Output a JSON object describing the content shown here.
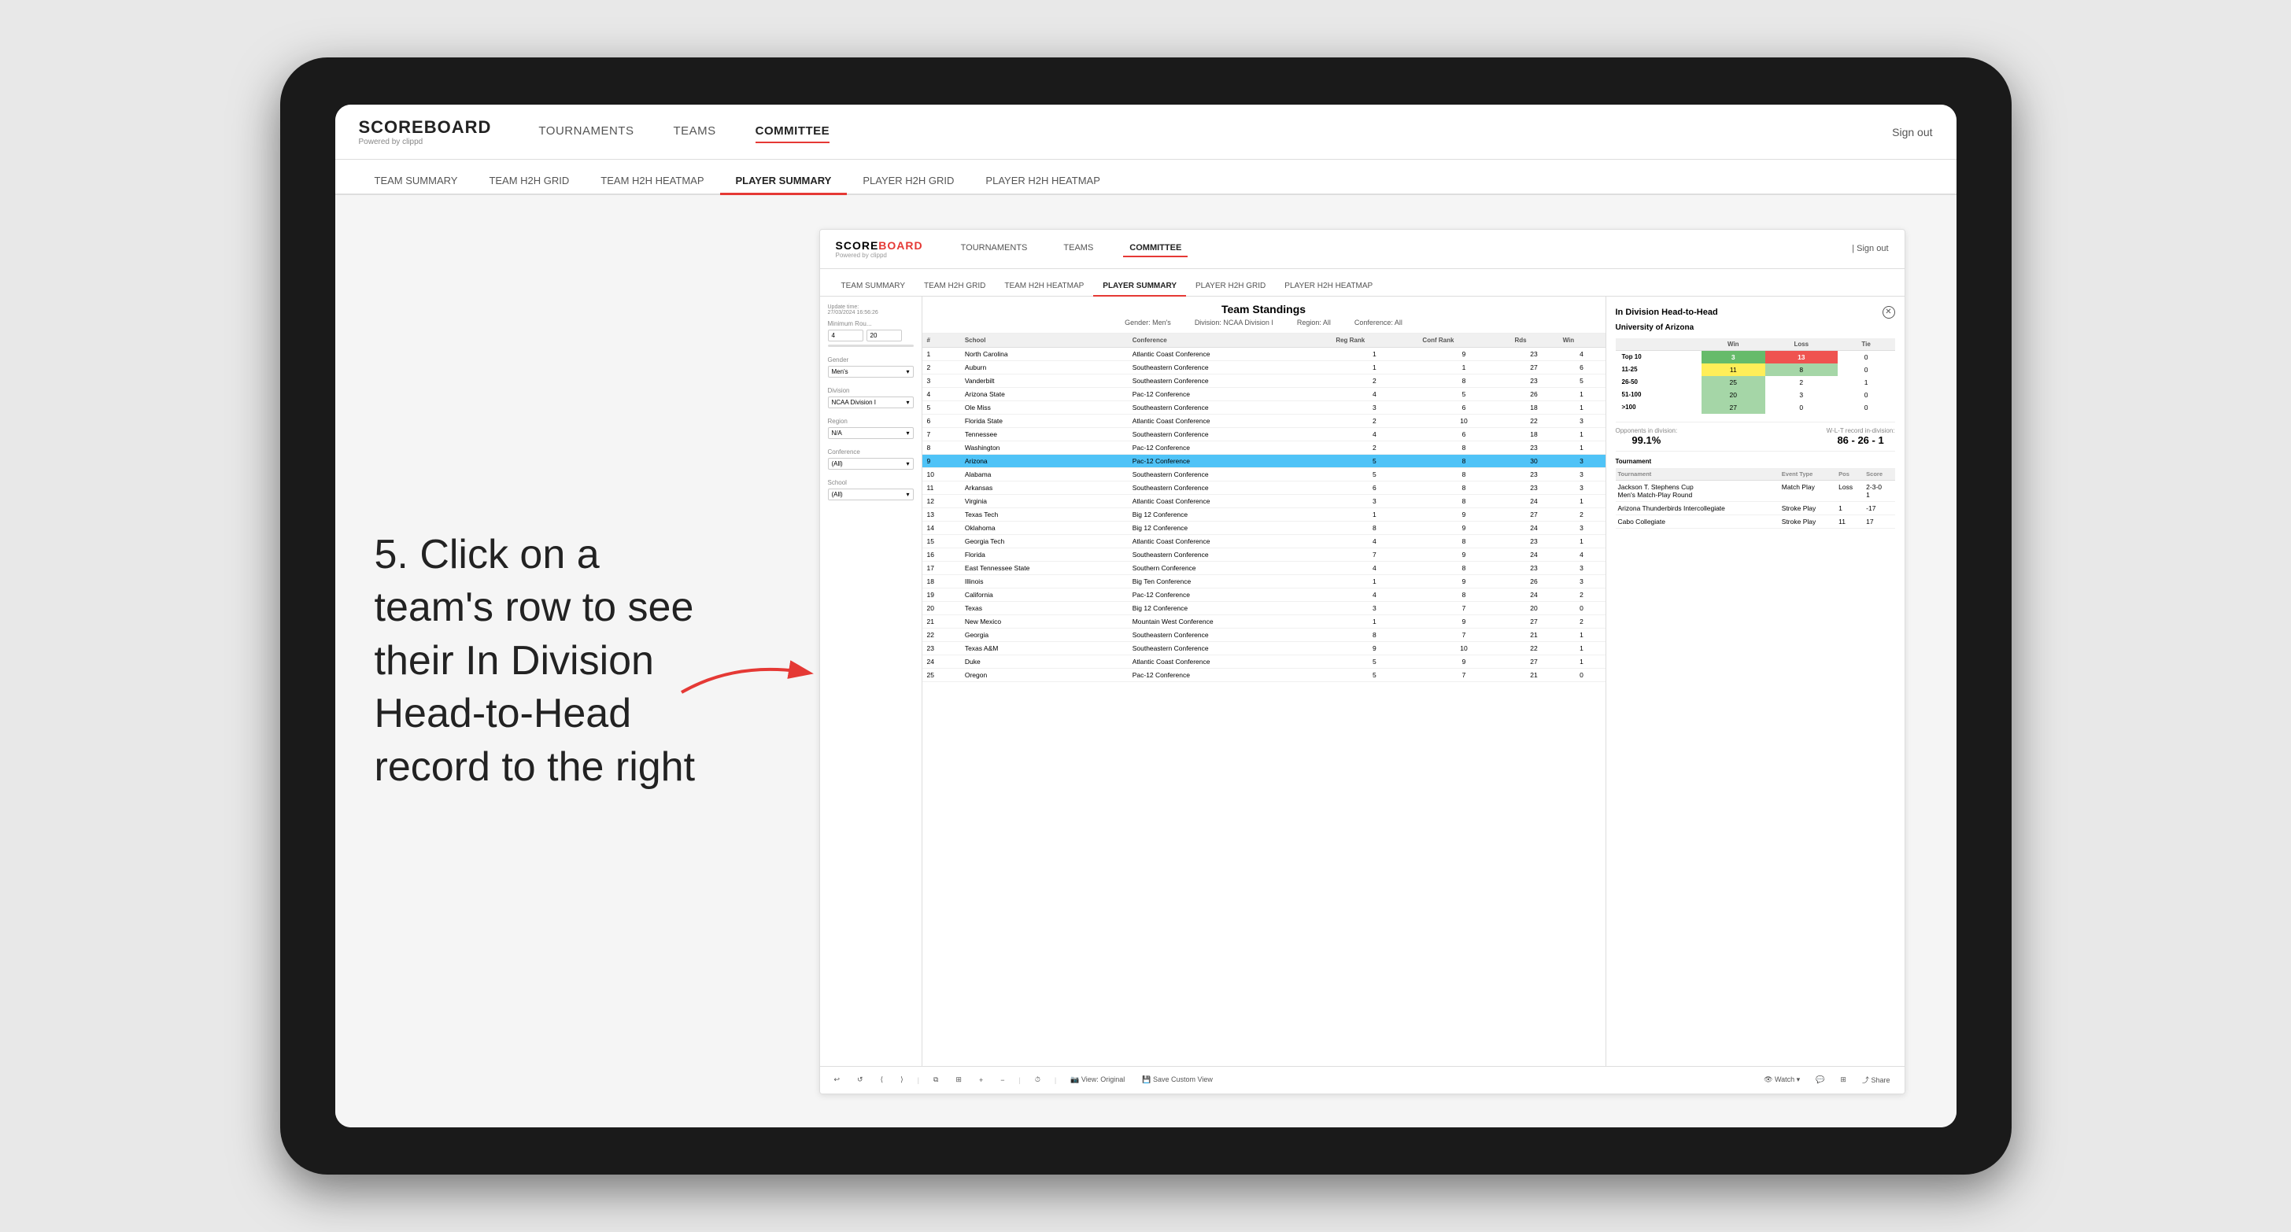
{
  "page": {
    "background": "#e8e8e8"
  },
  "nav": {
    "logo": "SCOREBOARD",
    "logo_sub": "Powered by clippd",
    "links": [
      "TOURNAMENTS",
      "TEAMS",
      "COMMITTEE"
    ],
    "active_link": "COMMITTEE",
    "sign_out": "Sign out",
    "sub_links": [
      "TEAM SUMMARY",
      "TEAM H2H GRID",
      "TEAM H2H HEATMAP",
      "PLAYER SUMMARY",
      "PLAYER H2H GRID",
      "PLAYER H2H HEATMAP"
    ],
    "active_sub": "PLAYER SUMMARY"
  },
  "instruction": {
    "text": "5. Click on a team's row to see their In Division Head-to-Head record to the right"
  },
  "app": {
    "header": {
      "logo": "SCOREBOARD",
      "logo_sub": "Powered by clippd",
      "nav_items": [
        "TOURNAMENTS",
        "TEAMS",
        "COMMITTEE"
      ],
      "active_nav": "COMMITTEE",
      "sign_out": "| Sign out"
    },
    "sub_nav": [
      "TEAM SUMMARY",
      "TEAM H2H GRID",
      "TEAM H2H HEATMAP",
      "PLAYER SUMMARY",
      "PLAYER H2H GRID",
      "PLAYER H2H HEATMAP"
    ],
    "active_sub": "PLAYER SUMMARY",
    "update_time": "Update time:\n27/03/2024 16:56:26",
    "table_title": "Team Standings",
    "meta": {
      "gender": "Gender: Men's",
      "division": "Division: NCAA Division I",
      "region": "Region: All",
      "conference": "Conference: All"
    },
    "filters": {
      "min_rounds_label": "Minimum Rou...",
      "min_val": "4",
      "max_val": "20",
      "gender_label": "Gender",
      "gender_val": "Men's",
      "division_label": "Division",
      "division_val": "NCAA Division I",
      "region_label": "Region",
      "region_val": "N/A",
      "conference_label": "Conference",
      "conference_val": "(All)",
      "school_label": "School",
      "school_val": "(All)"
    },
    "table_headers": [
      "#",
      "School",
      "Conference",
      "Reg Rank",
      "Conf Rank",
      "Rds",
      "Win"
    ],
    "table_rows": [
      {
        "num": "1",
        "school": "North Carolina",
        "conference": "Atlantic Coast Conference",
        "reg": "1",
        "conf": "9",
        "rds": "23",
        "win": "4"
      },
      {
        "num": "2",
        "school": "Auburn",
        "conference": "Southeastern Conference",
        "reg": "1",
        "conf": "1",
        "rds": "27",
        "win": "6"
      },
      {
        "num": "3",
        "school": "Vanderbilt",
        "conference": "Southeastern Conference",
        "reg": "2",
        "conf": "8",
        "rds": "23",
        "win": "5"
      },
      {
        "num": "4",
        "school": "Arizona State",
        "conference": "Pac-12 Conference",
        "reg": "4",
        "conf": "5",
        "rds": "26",
        "win": "1"
      },
      {
        "num": "5",
        "school": "Ole Miss",
        "conference": "Southeastern Conference",
        "reg": "3",
        "conf": "6",
        "rds": "18",
        "win": "1"
      },
      {
        "num": "6",
        "school": "Florida State",
        "conference": "Atlantic Coast Conference",
        "reg": "2",
        "conf": "10",
        "rds": "22",
        "win": "3"
      },
      {
        "num": "7",
        "school": "Tennessee",
        "conference": "Southeastern Conference",
        "reg": "4",
        "conf": "6",
        "rds": "18",
        "win": "1"
      },
      {
        "num": "8",
        "school": "Washington",
        "conference": "Pac-12 Conference",
        "reg": "2",
        "conf": "8",
        "rds": "23",
        "win": "1"
      },
      {
        "num": "9",
        "school": "Arizona",
        "conference": "Pac-12 Conference",
        "reg": "5",
        "conf": "8",
        "rds": "30",
        "win": "3",
        "selected": true
      },
      {
        "num": "10",
        "school": "Alabama",
        "conference": "Southeastern Conference",
        "reg": "5",
        "conf": "8",
        "rds": "23",
        "win": "3"
      },
      {
        "num": "11",
        "school": "Arkansas",
        "conference": "Southeastern Conference",
        "reg": "6",
        "conf": "8",
        "rds": "23",
        "win": "3"
      },
      {
        "num": "12",
        "school": "Virginia",
        "conference": "Atlantic Coast Conference",
        "reg": "3",
        "conf": "8",
        "rds": "24",
        "win": "1"
      },
      {
        "num": "13",
        "school": "Texas Tech",
        "conference": "Big 12 Conference",
        "reg": "1",
        "conf": "9",
        "rds": "27",
        "win": "2"
      },
      {
        "num": "14",
        "school": "Oklahoma",
        "conference": "Big 12 Conference",
        "reg": "8",
        "conf": "9",
        "rds": "24",
        "win": "3"
      },
      {
        "num": "15",
        "school": "Georgia Tech",
        "conference": "Atlantic Coast Conference",
        "reg": "4",
        "conf": "8",
        "rds": "23",
        "win": "1"
      },
      {
        "num": "16",
        "school": "Florida",
        "conference": "Southeastern Conference",
        "reg": "7",
        "conf": "9",
        "rds": "24",
        "win": "4"
      },
      {
        "num": "17",
        "school": "East Tennessee State",
        "conference": "Southern Conference",
        "reg": "4",
        "conf": "8",
        "rds": "23",
        "win": "3"
      },
      {
        "num": "18",
        "school": "Illinois",
        "conference": "Big Ten Conference",
        "reg": "1",
        "conf": "9",
        "rds": "26",
        "win": "3"
      },
      {
        "num": "19",
        "school": "California",
        "conference": "Pac-12 Conference",
        "reg": "4",
        "conf": "8",
        "rds": "24",
        "win": "2"
      },
      {
        "num": "20",
        "school": "Texas",
        "conference": "Big 12 Conference",
        "reg": "3",
        "conf": "7",
        "rds": "20",
        "win": "0"
      },
      {
        "num": "21",
        "school": "New Mexico",
        "conference": "Mountain West Conference",
        "reg": "1",
        "conf": "9",
        "rds": "27",
        "win": "2"
      },
      {
        "num": "22",
        "school": "Georgia",
        "conference": "Southeastern Conference",
        "reg": "8",
        "conf": "7",
        "rds": "21",
        "win": "1"
      },
      {
        "num": "23",
        "school": "Texas A&M",
        "conference": "Southeastern Conference",
        "reg": "9",
        "conf": "10",
        "rds": "22",
        "win": "1"
      },
      {
        "num": "24",
        "school": "Duke",
        "conference": "Atlantic Coast Conference",
        "reg": "5",
        "conf": "9",
        "rds": "27",
        "win": "1"
      },
      {
        "num": "25",
        "school": "Oregon",
        "conference": "Pac-12 Conference",
        "reg": "5",
        "conf": "7",
        "rds": "21",
        "win": "0"
      }
    ],
    "right_panel": {
      "title": "In Division Head-to-Head",
      "team": "University of Arizona",
      "h2h_headers": [
        "",
        "Win",
        "Loss",
        "Tie"
      ],
      "h2h_rows": [
        {
          "label": "Top 10",
          "win": "3",
          "loss": "13",
          "tie": "0",
          "win_class": "cell-green",
          "loss_class": "cell-red"
        },
        {
          "label": "11-25",
          "win": "11",
          "loss": "8",
          "tie": "0",
          "win_class": "cell-yellow",
          "loss_class": "cell-light-green"
        },
        {
          "label": "26-50",
          "win": "25",
          "loss": "2",
          "tie": "1",
          "win_class": "cell-light-green",
          "loss_class": ""
        },
        {
          "label": "51-100",
          "win": "20",
          "loss": "3",
          "tie": "0",
          "win_class": "cell-light-green",
          "loss_class": ""
        },
        {
          "label": ">100",
          "win": "27",
          "loss": "0",
          "tie": "0",
          "win_class": "cell-light-green",
          "loss_class": ""
        }
      ],
      "opponents_label": "Opponents in division:",
      "opponents_val": "99.1%",
      "wlt_label": "W-L-T record in-division:",
      "wlt_val": "86 - 26 - 1",
      "tournament_headers": [
        "Tournament",
        "Event Type",
        "Pos",
        "Score"
      ],
      "tournament_rows": [
        {
          "name": "Jackson T. Stephens Cup\nMen's Match-Play Round",
          "type": "Match Play",
          "pos": "Loss",
          "score": "2-3-0\n1"
        },
        {
          "name": "Arizona Thunderbirds Intercollegiate",
          "type": "Stroke Play",
          "pos": "1",
          "score": "-17"
        },
        {
          "name": "Cabo Collegiate",
          "type": "Stroke Play",
          "pos": "11",
          "score": "17"
        }
      ]
    },
    "toolbar": {
      "undo": "↩",
      "redo": "↪",
      "step_back": "⟨",
      "step_fwd": "⟩",
      "copy": "⧉",
      "paste": "⊞",
      "plus": "+",
      "minus": "−",
      "clock": "⏱",
      "view_original": "View: Original",
      "save_custom": "Save Custom View",
      "watch": "👁 Watch",
      "comment": "💬",
      "share": "⤴ Share"
    }
  }
}
